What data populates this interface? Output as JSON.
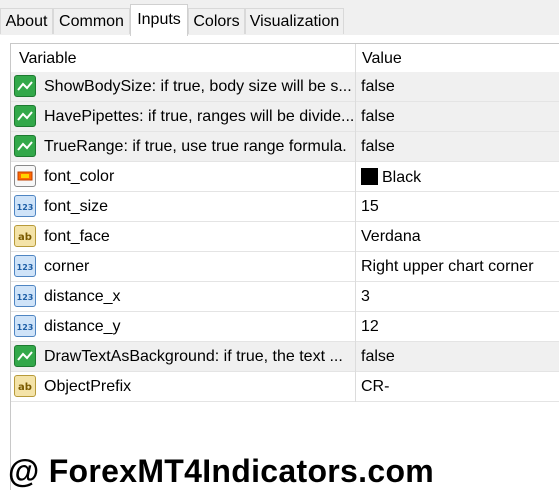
{
  "tabs": [
    {
      "label": "About"
    },
    {
      "label": "Common"
    },
    {
      "label": "Inputs"
    },
    {
      "label": "Colors"
    },
    {
      "label": "Visualization"
    }
  ],
  "active_tab": "Inputs",
  "grid": {
    "header_variable": "Variable",
    "header_value": "Value",
    "rows": [
      {
        "icon": "boolean-icon",
        "name": "ShowBodySize: if true, body size will be s...",
        "value": "false"
      },
      {
        "icon": "boolean-icon",
        "name": "HavePipettes: if true, ranges will be divide...",
        "value": "false"
      },
      {
        "icon": "boolean-icon",
        "name": "TrueRange: if true, use true range formula.",
        "value": "false"
      },
      {
        "icon": "color-icon",
        "name": "font_color",
        "value": "Black",
        "swatch": "#000000"
      },
      {
        "icon": "integer-icon",
        "name": "font_size",
        "value": "15"
      },
      {
        "icon": "string-icon",
        "name": "font_face",
        "value": "Verdana"
      },
      {
        "icon": "integer-icon",
        "name": "corner",
        "value": "Right upper chart corner"
      },
      {
        "icon": "integer-icon",
        "name": "distance_x",
        "value": "3"
      },
      {
        "icon": "integer-icon",
        "name": "distance_y",
        "value": "12"
      },
      {
        "icon": "boolean-icon",
        "name": "DrawTextAsBackground: if true, the text ...",
        "value": "false"
      },
      {
        "icon": "string-icon",
        "name": "ObjectPrefix",
        "value": "CR-"
      }
    ]
  },
  "icon_text": {
    "integer": "123",
    "string": "ab"
  },
  "watermark": "@ ForexMT4Indicators.com"
}
